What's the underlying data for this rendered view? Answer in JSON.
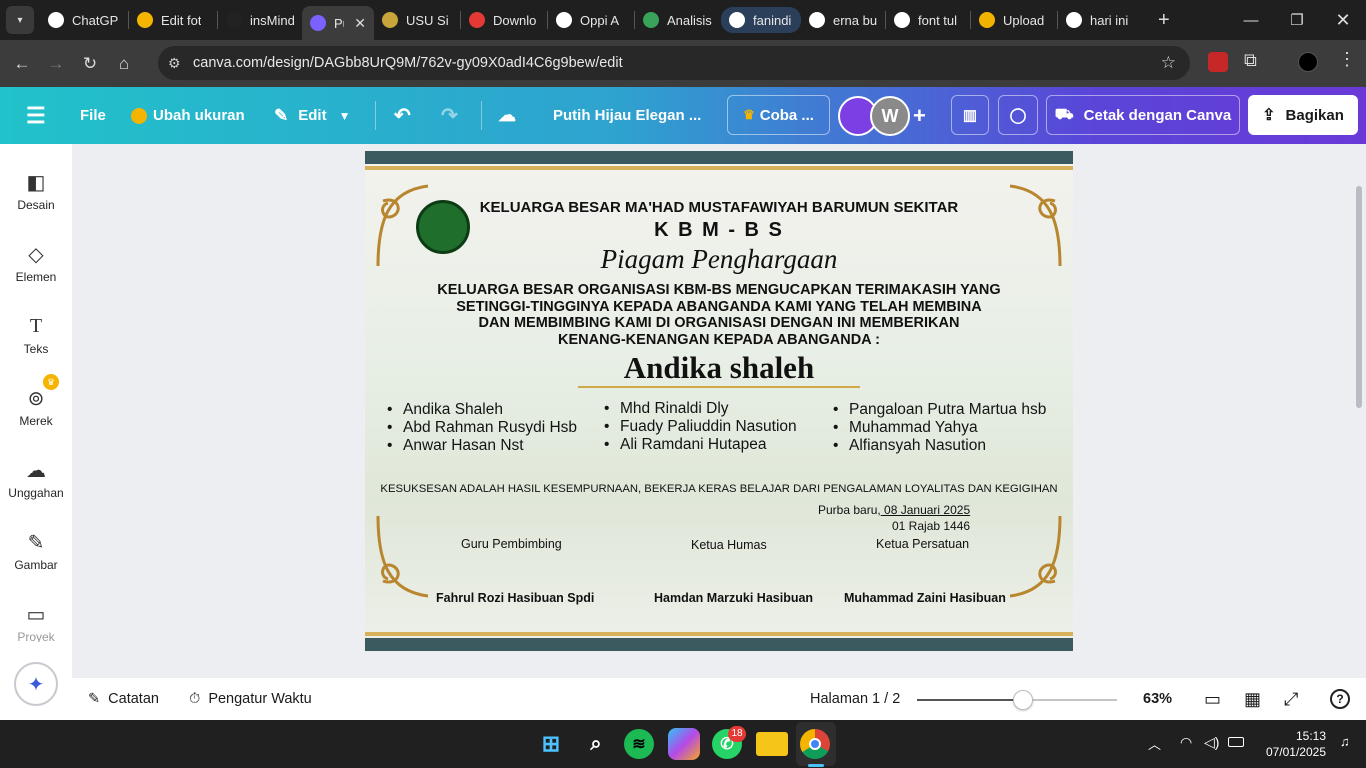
{
  "browser": {
    "tabs": [
      {
        "label": "ChatGP",
        "color": "#ffffff"
      },
      {
        "label": "Edit fot",
        "color": "#f4b400"
      },
      {
        "label": "insMind",
        "color": "#222222"
      },
      {
        "label": "Pu",
        "color": "#7b61ff"
      },
      {
        "label": "USU Si",
        "color": "#c8a43a"
      },
      {
        "label": "Downlo",
        "color": "#e53935"
      },
      {
        "label": "Oppi A",
        "color": "#ffffff"
      },
      {
        "label": "Analisis",
        "color": "#3aa35b"
      },
      {
        "label": "fanindi",
        "color": "#ffffff"
      },
      {
        "label": "erna bu",
        "color": "#ffffff"
      },
      {
        "label": "font tul",
        "color": "#ffffff"
      },
      {
        "label": "Upload",
        "color": "#f0b400"
      },
      {
        "label": "hari ini",
        "color": "#ffffff"
      }
    ],
    "url": "canva.com/design/DAGbb8UrQ9M/762v-gy09X0adI4C6g9bew/edit"
  },
  "toolbar": {
    "file": "File",
    "resize": "Ubah ukuran",
    "edit": "Edit",
    "doc_title": "Putih Hijau Elegan ...",
    "try_pro": "Coba ...",
    "avatar_letter": "W",
    "print": "Cetak dengan Canva",
    "share": "Bagikan"
  },
  "sidebar": {
    "items": [
      {
        "label": "Desain",
        "icon": "design-icon"
      },
      {
        "label": "Elemen",
        "icon": "elements-icon"
      },
      {
        "label": "Teks",
        "icon": "text-icon"
      },
      {
        "label": "Merek",
        "icon": "brand-icon"
      },
      {
        "label": "Unggahan",
        "icon": "upload-icon"
      },
      {
        "label": "Gambar",
        "icon": "draw-icon"
      },
      {
        "label": "Proyek",
        "icon": "folder-icon"
      }
    ]
  },
  "certificate": {
    "org": "KELUARGA BESAR MA'HAD MUSTAFAWIYAH BARUMUN SEKITAR",
    "short": "K B M - B S",
    "title": "Piagam Penghargaan",
    "message": [
      "KELUARGA BESAR ORGANISASI KBM-BS MENGUCAPKAN TERIMAKASIH YANG",
      "SETINGGI-TINGGINYA KEPADA ABANGANDA KAMI YANG TELAH MEMBINA",
      "DAN MEMBIMBING KAMI DI ORGANISASI DENGAN INI MEMBERIKAN",
      "KENANG-KENANGAN KEPADA ABANGANDA :"
    ],
    "recipient": "Andika shaleh",
    "names_col1": [
      "Andika Shaleh",
      "Abd Rahman Rusydi Hsb",
      "Anwar Hasan Nst"
    ],
    "names_col2": [
      "Mhd Rinaldi Dly",
      "Fuady Paliuddin Nasution",
      "Ali Ramdani Hutapea"
    ],
    "names_col3": [
      "Pangaloan Putra Martua hsb",
      "Muhammad Yahya",
      "Alfiansyah Nasution"
    ],
    "motto": "KESUKSESAN ADALAH HASIL KESEMPURNAAN, BEKERJA KERAS BELAJAR DARI PENGALAMAN LOYALITAS DAN KEGIGIHAN",
    "place": "Purba baru,",
    "date": " 08 Januari 2025",
    "hijri": "01 Rajab 1446",
    "roles": [
      "Guru Pembimbing",
      "Ketua Humas",
      "Ketua Persatuan"
    ],
    "signers": [
      "Fahrul Rozi Hasibuan Spdi",
      "Hamdan Marzuki Hasibuan",
      "Muhammad Zaini Hasibuan"
    ]
  },
  "bottombar": {
    "notes": "Catatan",
    "timer": "Pengatur Waktu",
    "page": "Halaman 1 / 2",
    "zoom": "63%",
    "zoom_level": 0.63
  },
  "taskbar": {
    "whatsapp_badge": "18",
    "time": "15:13",
    "date": "07/01/2025"
  },
  "colors": {
    "teal": "#21c2ca",
    "purple": "#6a3ad9",
    "band": "#3b5a60",
    "gold": "#d7b15a"
  }
}
